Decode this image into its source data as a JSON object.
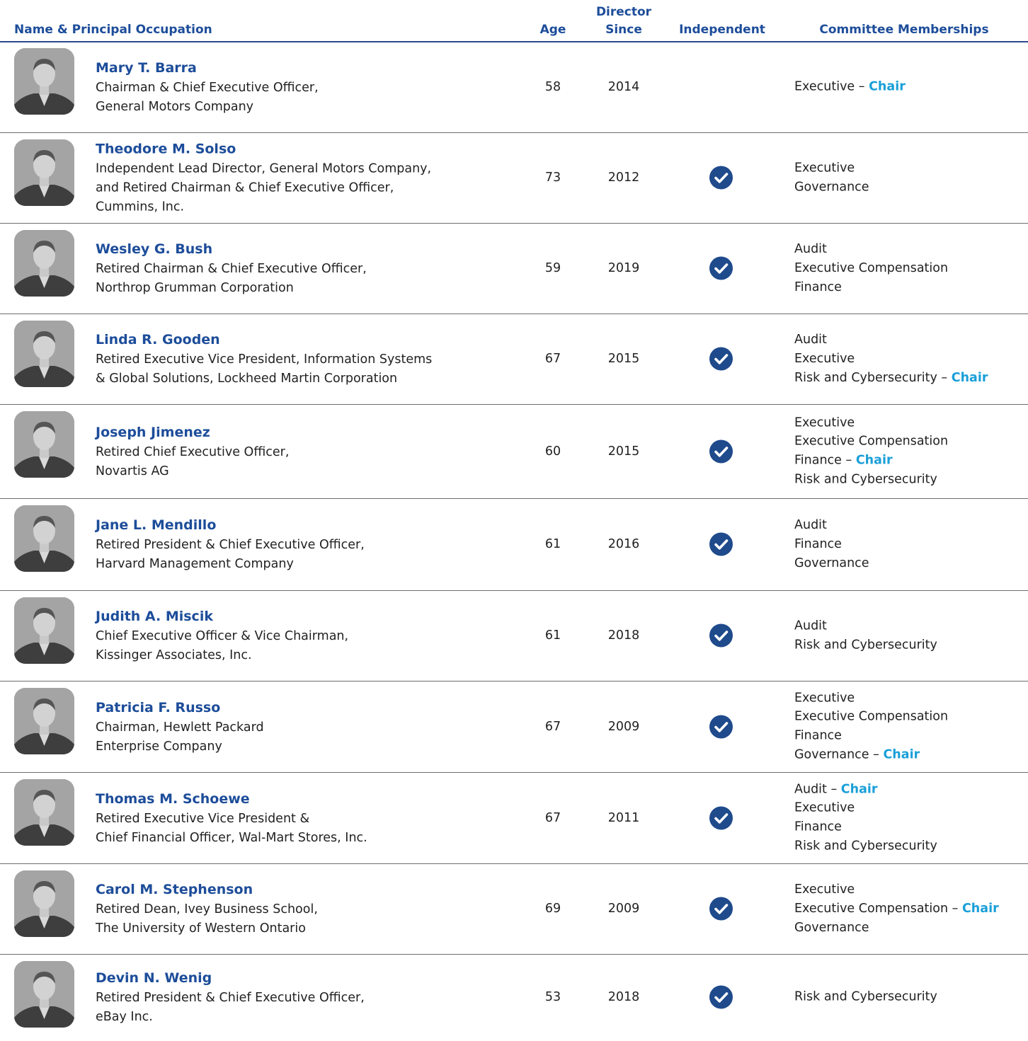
{
  "header": {
    "name_col": "Name & Principal Occupation",
    "age_col": "Age",
    "director_since_col_1": "Director",
    "director_since_col_2": "Since",
    "independent_col": "Independent",
    "committees_col": "Committee Memberships"
  },
  "chair_label": "Chair",
  "colors": {
    "heading_blue": "#1d4d9a",
    "chair_blue": "#1a9fd8",
    "check_navy": "#1f4a8c"
  },
  "directors": [
    {
      "name": "Mary T. Barra",
      "occupation": [
        "Chairman & Chief Executive Officer,",
        "General Motors Company"
      ],
      "age": "58",
      "since": "2014",
      "independent": false,
      "committees": [
        {
          "label": "Executive",
          "suffix": " – ",
          "chair": true
        }
      ]
    },
    {
      "name": "Theodore M. Solso",
      "occupation": [
        "Independent Lead Director, General Motors Company,",
        "and Retired Chairman & Chief Executive Officer,",
        "Cummins, Inc."
      ],
      "age": "73",
      "since": "2012",
      "independent": true,
      "committees": [
        {
          "label": "Executive"
        },
        {
          "label": "Governance"
        }
      ]
    },
    {
      "name": "Wesley G. Bush",
      "occupation": [
        "Retired Chairman & Chief Executive Officer,",
        "Northrop Grumman Corporation"
      ],
      "age": "59",
      "since": "2019",
      "independent": true,
      "committees": [
        {
          "label": "Audit"
        },
        {
          "label": "Executive Compensation"
        },
        {
          "label": "Finance"
        }
      ]
    },
    {
      "name": "Linda R. Gooden",
      "occupation": [
        "Retired Executive Vice President, Information Systems",
        "& Global Solutions, Lockheed Martin Corporation"
      ],
      "age": "67",
      "since": "2015",
      "independent": true,
      "committees": [
        {
          "label": "Audit"
        },
        {
          "label": "Executive"
        },
        {
          "label": "Risk and Cybersecurity",
          "suffix": " – ",
          "chair": true
        }
      ]
    },
    {
      "name": "Joseph Jimenez",
      "occupation": [
        "Retired Chief Executive Officer,",
        "Novartis AG"
      ],
      "age": "60",
      "since": "2015",
      "independent": true,
      "committees": [
        {
          "label": "Executive"
        },
        {
          "label": "Executive Compensation"
        },
        {
          "label": "Finance",
          "suffix": " – ",
          "chair": true
        },
        {
          "label": "Risk and Cybersecurity"
        }
      ]
    },
    {
      "name": "Jane L. Mendillo",
      "occupation": [
        "Retired President & Chief Executive Officer,",
        "Harvard Management Company"
      ],
      "age": "61",
      "since": "2016",
      "independent": true,
      "committees": [
        {
          "label": "Audit"
        },
        {
          "label": "Finance"
        },
        {
          "label": "Governance"
        }
      ]
    },
    {
      "name": "Judith A. Miscik",
      "occupation": [
        "Chief Executive Officer & Vice Chairman,",
        "Kissinger Associates, Inc."
      ],
      "age": "61",
      "since": "2018",
      "independent": true,
      "committees": [
        {
          "label": "Audit"
        },
        {
          "label": "Risk and Cybersecurity"
        }
      ]
    },
    {
      "name": "Patricia F. Russo",
      "occupation": [
        "Chairman, Hewlett Packard",
        "Enterprise Company"
      ],
      "age": "67",
      "since": "2009",
      "independent": true,
      "committees": [
        {
          "label": "Executive"
        },
        {
          "label": "Executive Compensation"
        },
        {
          "label": "Finance"
        },
        {
          "label": "Governance",
          "suffix": " – ",
          "chair": true
        }
      ]
    },
    {
      "name": "Thomas M. Schoewe",
      "occupation": [
        "Retired Executive Vice President &",
        "Chief Financial Officer, Wal-Mart Stores, Inc."
      ],
      "age": "67",
      "since": "2011",
      "independent": true,
      "committees": [
        {
          "label": "Audit",
          "suffix": " – ",
          "chair": true
        },
        {
          "label": "Executive"
        },
        {
          "label": "Finance"
        },
        {
          "label": "Risk and Cybersecurity"
        }
      ]
    },
    {
      "name": "Carol M. Stephenson",
      "occupation": [
        "Retired Dean, Ivey Business School,",
        "The University of Western Ontario"
      ],
      "age": "69",
      "since": "2009",
      "independent": true,
      "committees": [
        {
          "label": "Executive"
        },
        {
          "label": "Executive Compensation",
          "suffix": " – ",
          "chair": true
        },
        {
          "label": "Governance"
        }
      ]
    },
    {
      "name": "Devin N. Wenig",
      "occupation": [
        "Retired President & Chief Executive Officer,",
        "eBay Inc."
      ],
      "age": "53",
      "since": "2018",
      "independent": true,
      "committees": [
        {
          "label": "Risk and Cybersecurity"
        }
      ]
    }
  ]
}
